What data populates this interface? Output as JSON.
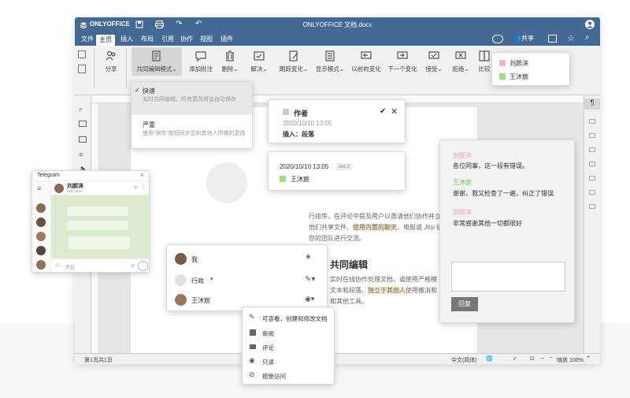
{
  "app": {
    "logo": "ONLYOFFICE",
    "doc_title": "ONLYOFFICE 文档.docx"
  },
  "menu": {
    "tabs": [
      "文件",
      "主页",
      "插入",
      "布局",
      "引用",
      "协作",
      "视图",
      "插件"
    ],
    "active": "主页",
    "share_label": "共享"
  },
  "toolbar": {
    "share": "分享",
    "co_edit_mode": "共同编辑模式",
    "add_comment": "添加批注",
    "delete": "删除",
    "resolve": "解决",
    "track_changes": "跟踪变化",
    "display_mode": "显示模式",
    "prev_change": "以前的变化",
    "next_change": "下一个变化",
    "accept": "接受",
    "reject": "拒绝",
    "compare": "比较"
  },
  "coedit_dropdown": {
    "fast_title": "快速",
    "fast_desc": "实时共同编辑。所有更改将会自动保存",
    "strict_title": "严重",
    "strict_desc": "使用“保存”按钮同步您和其他人所做的更改"
  },
  "users_popup": {
    "users": [
      {
        "name": "刘颜涞",
        "color": "#f2b6c3"
      },
      {
        "name": "王沐宸",
        "color": "#9be07a"
      }
    ]
  },
  "change_card": {
    "author_label": "作者",
    "date": "2020/10/10 13:05",
    "action": "插入：段落"
  },
  "version_card": {
    "date": "2020/10/10 13:05",
    "version": "ver.2",
    "user": "王沐宸",
    "user_color": "#9be07a"
  },
  "document": {
    "para1": [
      "日期对评论",
      "行排序。在评论中提及用户以邀请他们协作并立即",
      "他们共享文件。",
      "使用内置的聊天",
      "、电报或 Jitsi 插件",
      "您的团队进行交流。"
    ],
    "heading": "共同编辑",
    "para2": [
      "实时在线协作处理文档，或使用严格模",
      "文本和段落。",
      "独立于其他人",
      "使用撤消和",
      "和其他工具。"
    ]
  },
  "comments_panel": {
    "comments": [
      {
        "author": "刘颜涞",
        "color": "#f2a0b8",
        "text": "各位同事，这一段有错误。"
      },
      {
        "author": "王沐宸",
        "color": "#7bc94a",
        "text": "谢谢，我又检查了一遍，纠正了错误"
      },
      {
        "author": "刘颜涞",
        "color": "#f2a0b8",
        "text": "非常感谢其他一切都很好"
      }
    ],
    "reply_button": "回复"
  },
  "telegram": {
    "title": "Telegram",
    "contact_name": "刘颜涞",
    "contact_status": "last seen",
    "input_placeholder": "评论"
  },
  "share_panel": {
    "rows": [
      {
        "name": "我"
      },
      {
        "name": "行政"
      },
      {
        "name": "王沐宸"
      }
    ]
  },
  "permission_menu": {
    "items": [
      {
        "label": "可查看，创建和修改文档",
        "icon": "pencil-icon"
      },
      {
        "label": "审阅",
        "icon": "review-icon"
      },
      {
        "label": "评论",
        "icon": "comment-icon"
      },
      {
        "label": "只读",
        "icon": "eye-icon"
      },
      {
        "label": "拒绝访问",
        "icon": "eye-slash-icon"
      }
    ]
  },
  "statusbar": {
    "page_info": "第1页共1页",
    "language": "中文(简体)",
    "zoom": "缩放 100%"
  }
}
